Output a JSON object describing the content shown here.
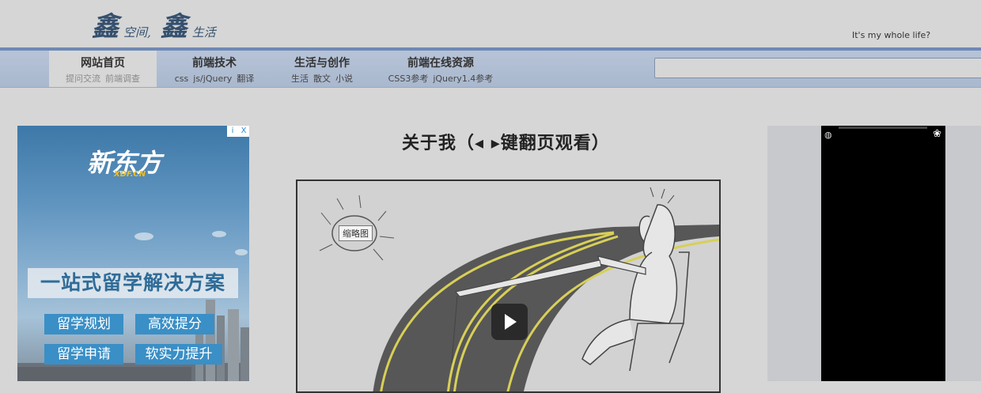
{
  "header": {
    "logo_big_1": "鑫",
    "logo_small_1": "空间,",
    "logo_big_2": "鑫",
    "logo_small_2": "生活",
    "tagline": "It's my whole life?"
  },
  "nav": {
    "items": [
      {
        "title": "网站首页",
        "subs": [
          "提问交流",
          "前端调查"
        ]
      },
      {
        "title": "前端技术",
        "subs": [
          "css",
          "js/jQuery",
          "翻译"
        ]
      },
      {
        "title": "生活与创作",
        "subs": [
          "生活",
          "散文",
          "小说"
        ]
      },
      {
        "title": "前端在线资源",
        "subs": [
          "CSS3参考",
          "jQuery1.4参考"
        ]
      }
    ],
    "search_value": ""
  },
  "ad": {
    "brand": "新东方",
    "brand_sub": "XDF.CN",
    "headline": "一站式留学解决方案",
    "buttons": [
      "留学规划",
      "高效提分",
      "留学申请",
      "软实力提升"
    ],
    "info_icon": "i",
    "close_icon": "X"
  },
  "main": {
    "title": "关于我（◂ ▸键翻页观看）",
    "thumbnail_label": "缩略图"
  },
  "right_player": {
    "left_icon": "shell-icon",
    "right_icon": "paw-icon"
  },
  "colors": {
    "nav_top": "#6f89b5",
    "nav_bg": "#b7c3d7",
    "road": "#555555",
    "road_line": "#d8cf58"
  }
}
